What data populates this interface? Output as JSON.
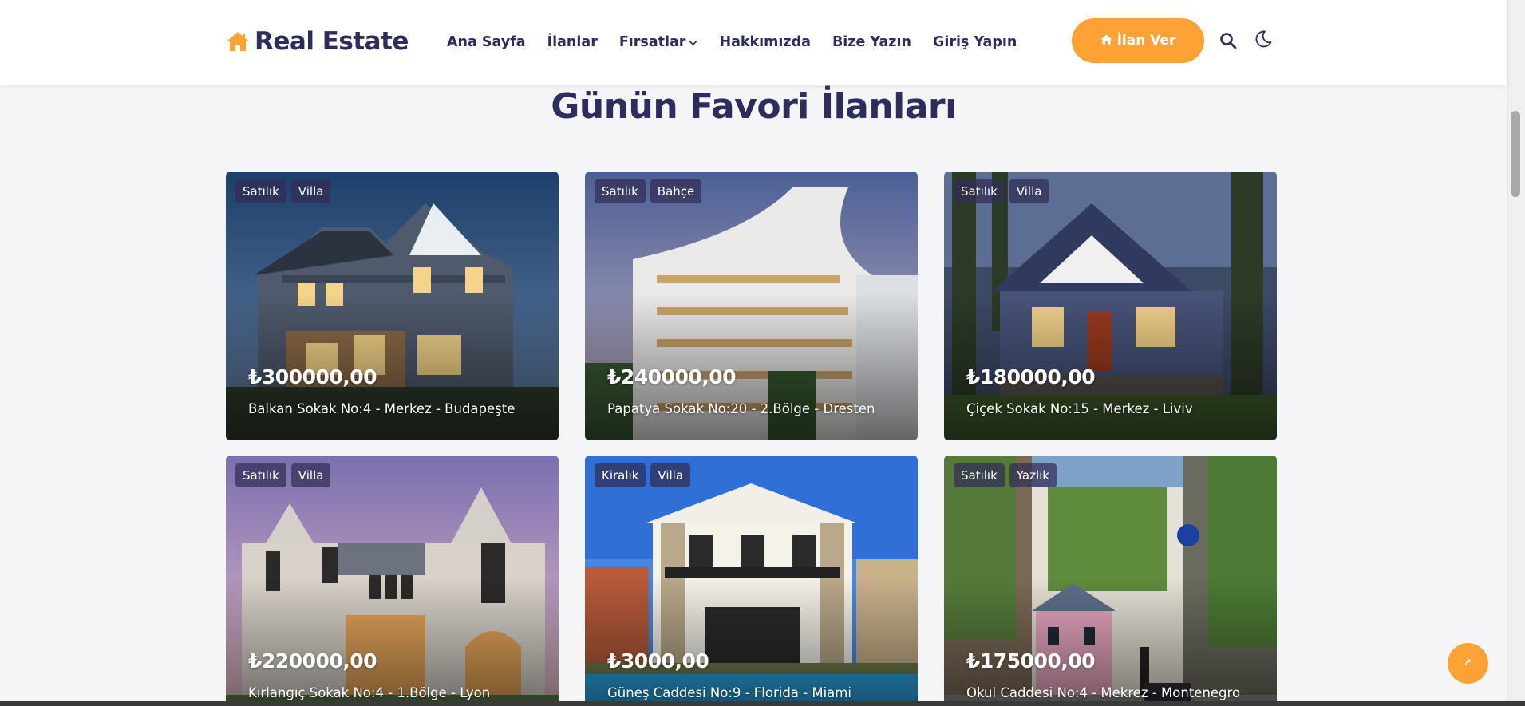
{
  "header": {
    "brand": "Real Estate",
    "nav": [
      {
        "label": "Ana Sayfa"
      },
      {
        "label": "İlanlar"
      },
      {
        "label": "Fırsatlar",
        "dropdown": true
      },
      {
        "label": "Hakkımızda"
      },
      {
        "label": "Bize Yazın"
      },
      {
        "label": "Giriş Yapın"
      }
    ],
    "cta_label": "İlan Ver",
    "accent_color": "#ffa236",
    "text_color": "#2e2c5c"
  },
  "section": {
    "title": "Günün Favori İlanları"
  },
  "listings": [
    {
      "tags": [
        "Satılık",
        "Villa"
      ],
      "price": "₺300000,00",
      "address": "Balkan Sokak No:4 - Merkez - Budapeşte",
      "image": "house-dusk-gray"
    },
    {
      "tags": [
        "Satılık",
        "Bahçe"
      ],
      "price": "₺240000,00",
      "address": "Papatya Sokak No:20 - 2.Bölge - Dresten",
      "image": "modern-apartment-white"
    },
    {
      "tags": [
        "Satılık",
        "Villa"
      ],
      "price": "₺180000,00",
      "address": "Çiçek Sokak No:15 - Merkez - Liviv",
      "image": "craftsman-house-blue"
    },
    {
      "tags": [
        "Satılık",
        "Villa"
      ],
      "price": "₺220000,00",
      "address": "Kırlangıç Sokak No:4 - 1.Bölge - Lyon",
      "image": "stone-house-sunset"
    },
    {
      "tags": [
        "Kiralık",
        "Villa"
      ],
      "price": "₺3000,00",
      "address": "Güneş Caddesi No:9 - Florida - Miami",
      "image": "white-villa-pool"
    },
    {
      "tags": [
        "Satılık",
        "Yazlık"
      ],
      "price": "₺175000,00",
      "address": "Okul Caddesi No:4 - Mekrez - Montenegro",
      "image": "street-pink-house"
    }
  ]
}
